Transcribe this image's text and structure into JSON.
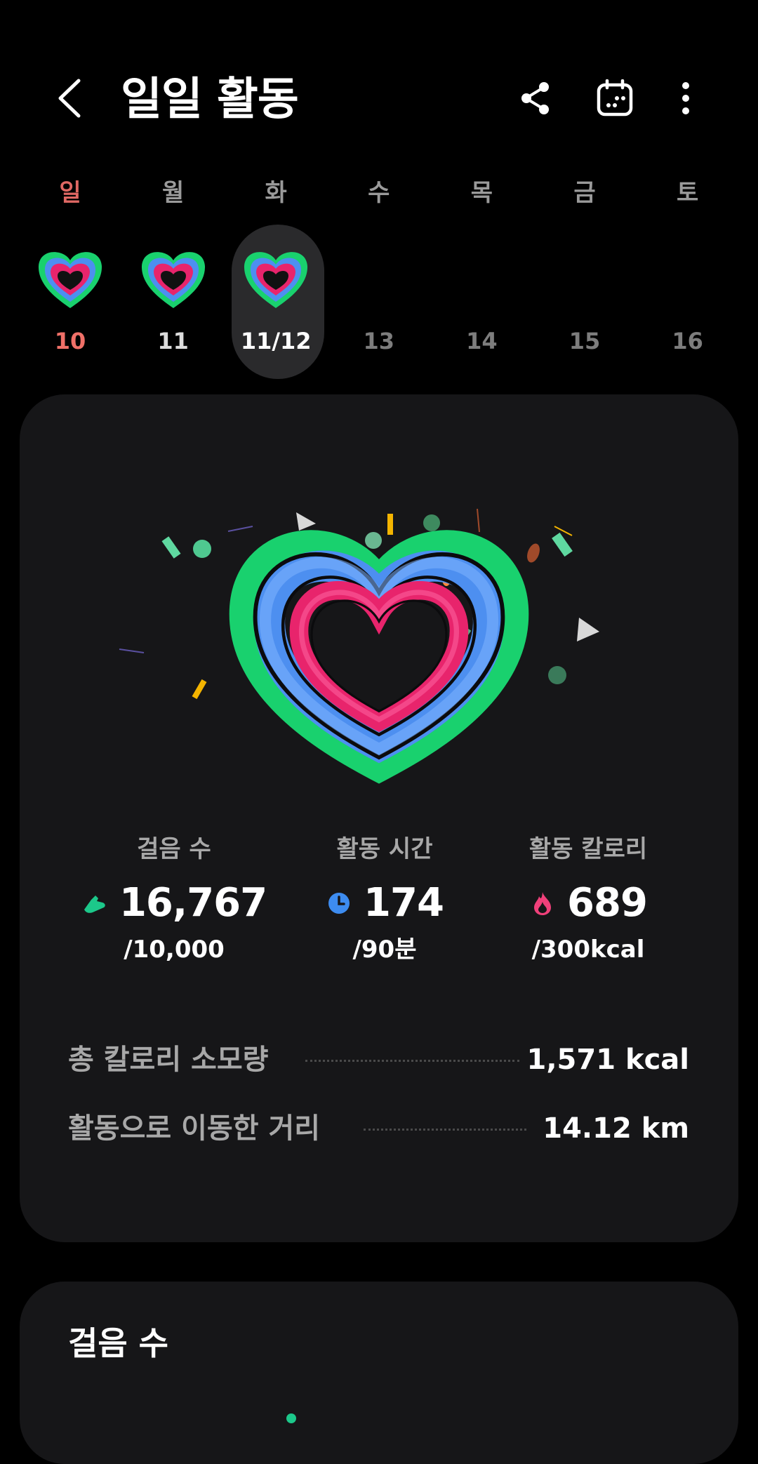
{
  "header": {
    "title": "일일 활동",
    "icons": [
      "back-chevron-icon",
      "share-icon",
      "calendar-icon",
      "more-vert-icon"
    ]
  },
  "week": {
    "days": [
      {
        "name": "일",
        "date": "10",
        "state": "past",
        "sunday": true
      },
      {
        "name": "월",
        "date": "11",
        "state": "past",
        "sunday": false
      },
      {
        "name": "화",
        "date": "11/12",
        "state": "selected",
        "sunday": false
      },
      {
        "name": "수",
        "date": "13",
        "state": "future",
        "sunday": false
      },
      {
        "name": "목",
        "date": "14",
        "state": "future",
        "sunday": false
      },
      {
        "name": "금",
        "date": "15",
        "state": "future",
        "sunday": false
      },
      {
        "name": "토",
        "date": "16",
        "state": "future",
        "sunday": false
      }
    ]
  },
  "stats": [
    {
      "label": "걸음 수",
      "value": "16,767",
      "goal": "/10,000",
      "icon": "shoe-icon",
      "color": "#1cc88a"
    },
    {
      "label": "활동 시간",
      "value": "174",
      "goal": "/90분",
      "icon": "clock-icon",
      "color": "#3d8cf0"
    },
    {
      "label": "활동 칼로리",
      "value": "689",
      "goal": "/300kcal",
      "icon": "flame-icon",
      "color": "#f0407a"
    }
  ],
  "summary": {
    "total_calories_label": "총 칼로리 소모량",
    "total_calories_value": "1,571  kcal",
    "distance_label": "활동으로 이동한 거리",
    "distance_value": "14.12  km"
  },
  "steps_section": {
    "title": "걸음 수"
  },
  "colors": {
    "ring_green": "#19d16e",
    "ring_blue": "#4d8ff0",
    "ring_light_blue": "#7fb4ff",
    "ring_pink": "#e8246c",
    "card_bg": "#161618",
    "sunday_red": "#e06864"
  }
}
